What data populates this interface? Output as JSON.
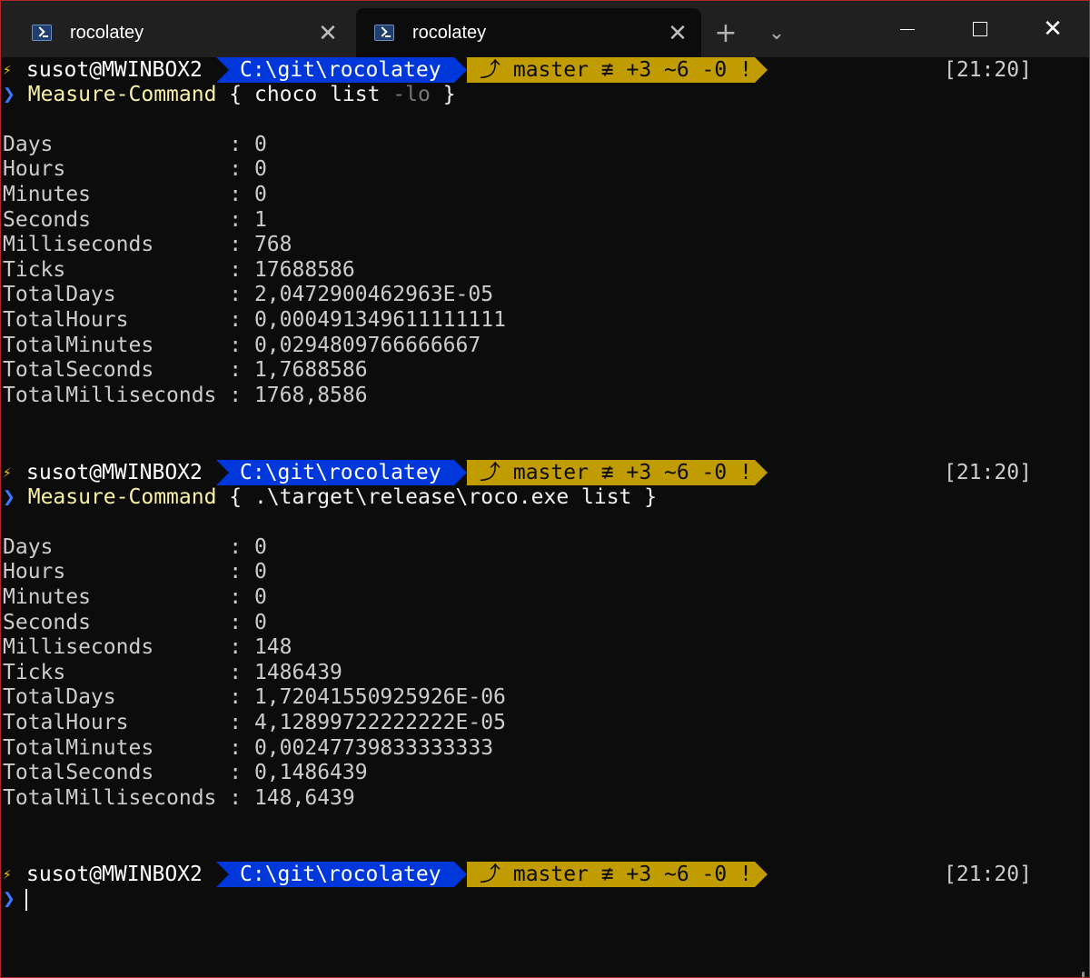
{
  "tabs": [
    {
      "label": "rocolatey",
      "active": false
    },
    {
      "label": "rocolatey",
      "active": true
    }
  ],
  "titlebar": {
    "new_tab": "+",
    "dropdown": "⌄",
    "close": "✕"
  },
  "prompt": {
    "bolt": "⚡",
    "user": "susot@MWINBOX2",
    "path": "C:\\git\\rocolatey",
    "git": "⤴ master ≢ +3 ~6 -0 !",
    "time": "[21:20]",
    "chevron": "❯"
  },
  "commands": [
    {
      "name": "Measure-Command",
      "open": " { ",
      "arg": "choco list ",
      "flag": "-lo",
      "close": " }",
      "output": [
        {
          "label": "Days",
          "value": "0"
        },
        {
          "label": "Hours",
          "value": "0"
        },
        {
          "label": "Minutes",
          "value": "0"
        },
        {
          "label": "Seconds",
          "value": "1"
        },
        {
          "label": "Milliseconds",
          "value": "768"
        },
        {
          "label": "Ticks",
          "value": "17688586"
        },
        {
          "label": "TotalDays",
          "value": "2,0472900462963E-05"
        },
        {
          "label": "TotalHours",
          "value": "0,000491349611111111"
        },
        {
          "label": "TotalMinutes",
          "value": "0,0294809766666667"
        },
        {
          "label": "TotalSeconds",
          "value": "1,7688586"
        },
        {
          "label": "TotalMilliseconds",
          "value": "1768,8586"
        }
      ]
    },
    {
      "name": "Measure-Command",
      "open": " { ",
      "arg": ".\\target\\release\\roco.exe list",
      "flag": "",
      "close": " }",
      "output": [
        {
          "label": "Days",
          "value": "0"
        },
        {
          "label": "Hours",
          "value": "0"
        },
        {
          "label": "Minutes",
          "value": "0"
        },
        {
          "label": "Seconds",
          "value": "0"
        },
        {
          "label": "Milliseconds",
          "value": "148"
        },
        {
          "label": "Ticks",
          "value": "1486439"
        },
        {
          "label": "TotalDays",
          "value": "1,72041550925926E-06"
        },
        {
          "label": "TotalHours",
          "value": "4,12899722222222E-05"
        },
        {
          "label": "TotalMinutes",
          "value": "0,00247739833333333"
        },
        {
          "label": "TotalSeconds",
          "value": "0,1486439"
        },
        {
          "label": "TotalMilliseconds",
          "value": "148,6439"
        }
      ]
    }
  ],
  "colors": {
    "path_bg": "#0037da",
    "git_bg": "#c19c00",
    "chevron": "#3b78ff",
    "command": "#f9f1a5",
    "background": "#0c0c0c"
  }
}
